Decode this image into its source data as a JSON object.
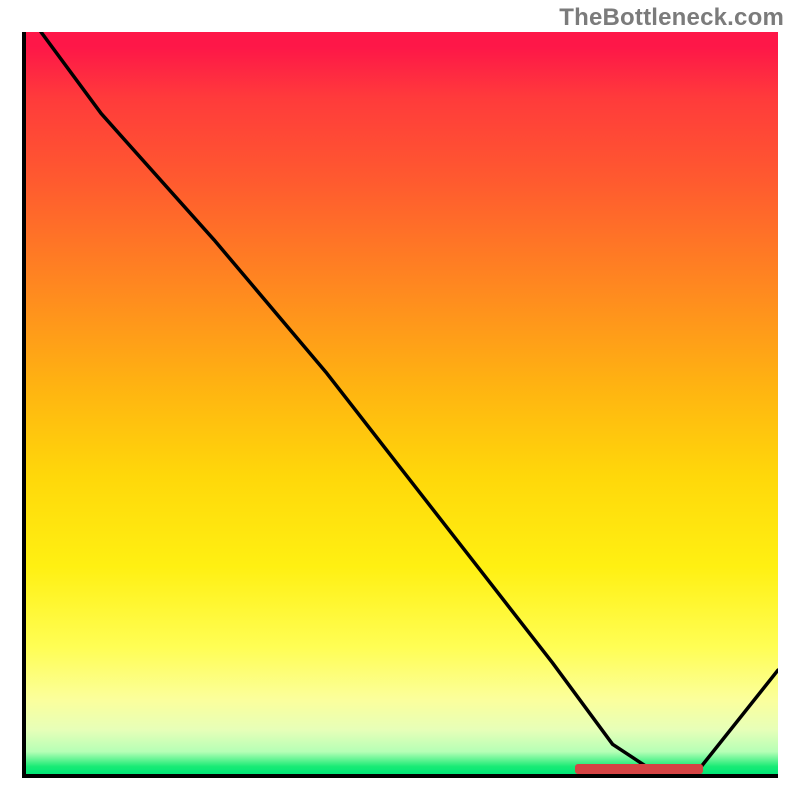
{
  "watermark": "TheBottleneck.com",
  "chart_data": {
    "type": "line",
    "title": "",
    "xlabel": "",
    "ylabel": "",
    "xlim": [
      0,
      100
    ],
    "ylim": [
      0,
      100
    ],
    "x": [
      2,
      10,
      25,
      30,
      40,
      50,
      60,
      70,
      78,
      84,
      89,
      100
    ],
    "values": [
      100,
      89,
      72,
      66,
      54,
      41,
      28,
      15,
      4,
      0,
      0,
      14
    ],
    "marker_range_x": [
      73,
      90
    ],
    "gradient_stops": [
      {
        "pos": 0,
        "color": "#fe1748"
      },
      {
        "pos": 35,
        "color": "#ff8a1f"
      },
      {
        "pos": 60,
        "color": "#ffd80a"
      },
      {
        "pos": 85,
        "color": "#fbff9c"
      },
      {
        "pos": 100,
        "color": "#00e676"
      }
    ]
  }
}
